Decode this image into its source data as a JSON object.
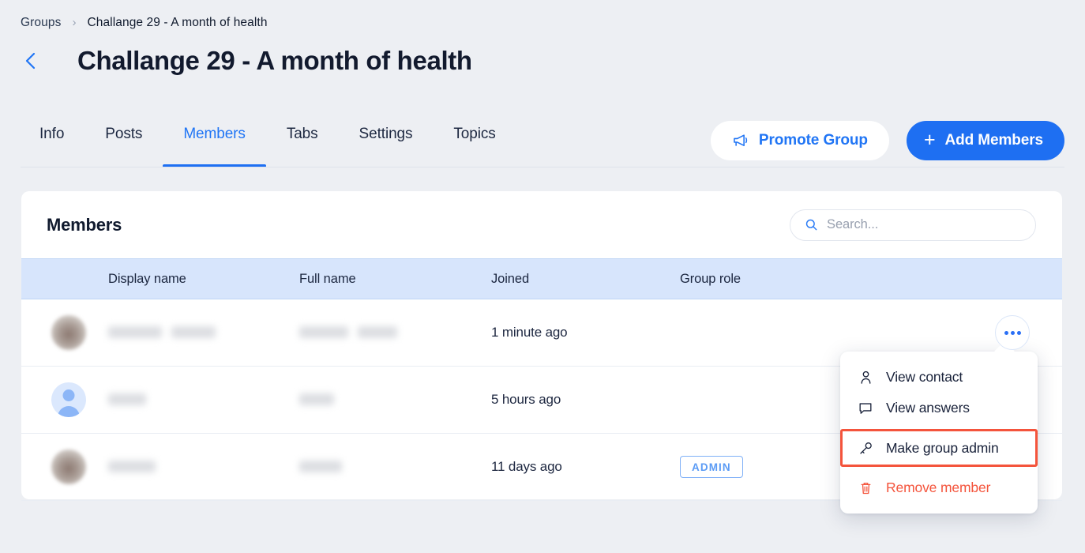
{
  "breadcrumb": {
    "root": "Groups",
    "separator": "›",
    "current": "Challange 29 - A month of health"
  },
  "header": {
    "back_icon": "chevron-left-icon",
    "title": "Challange 29 - A month of health"
  },
  "tabs": [
    {
      "label": "Info",
      "active": false
    },
    {
      "label": "Posts",
      "active": false
    },
    {
      "label": "Members",
      "active": true
    },
    {
      "label": "Tabs",
      "active": false
    },
    {
      "label": "Settings",
      "active": false
    },
    {
      "label": "Topics",
      "active": false
    }
  ],
  "actions": {
    "promote_label": "Promote Group",
    "promote_icon": "megaphone-icon",
    "add_label": "Add Members",
    "add_icon": "plus-icon"
  },
  "card": {
    "title": "Members",
    "search": {
      "placeholder": "Search...",
      "value": "",
      "icon": "search-icon"
    },
    "columns": [
      "",
      "Display name",
      "Full name",
      "Joined",
      "Group role"
    ],
    "rows": [
      {
        "avatar": "photo",
        "display_name": "",
        "full_name": "",
        "joined": "1 minute ago",
        "role": "",
        "menu_open": true
      },
      {
        "avatar": "default-person",
        "display_name": "",
        "full_name": "",
        "joined": "5 hours ago",
        "role": "",
        "menu_open": false
      },
      {
        "avatar": "photo",
        "display_name": "",
        "full_name": "",
        "joined": "11 days ago",
        "role": "ADMIN",
        "menu_open": false
      }
    ]
  },
  "context_menu": {
    "items": [
      {
        "label": "View contact",
        "icon": "person-icon",
        "style": "normal"
      },
      {
        "label": "View answers",
        "icon": "comment-icon",
        "style": "normal"
      },
      {
        "label": "Make group admin",
        "icon": "key-icon",
        "style": "highlighted"
      },
      {
        "label": "Remove member",
        "icon": "trash-icon",
        "style": "danger"
      }
    ]
  },
  "colors": {
    "page_bg": "#edeff3",
    "accent_blue": "#1e6ff2",
    "tab_active": "#2075f5",
    "table_header_bg": "#d7e5fc",
    "danger_red": "#f4543c",
    "badge_blue": "#5b9bf5",
    "title_navy": "#121a2e"
  }
}
